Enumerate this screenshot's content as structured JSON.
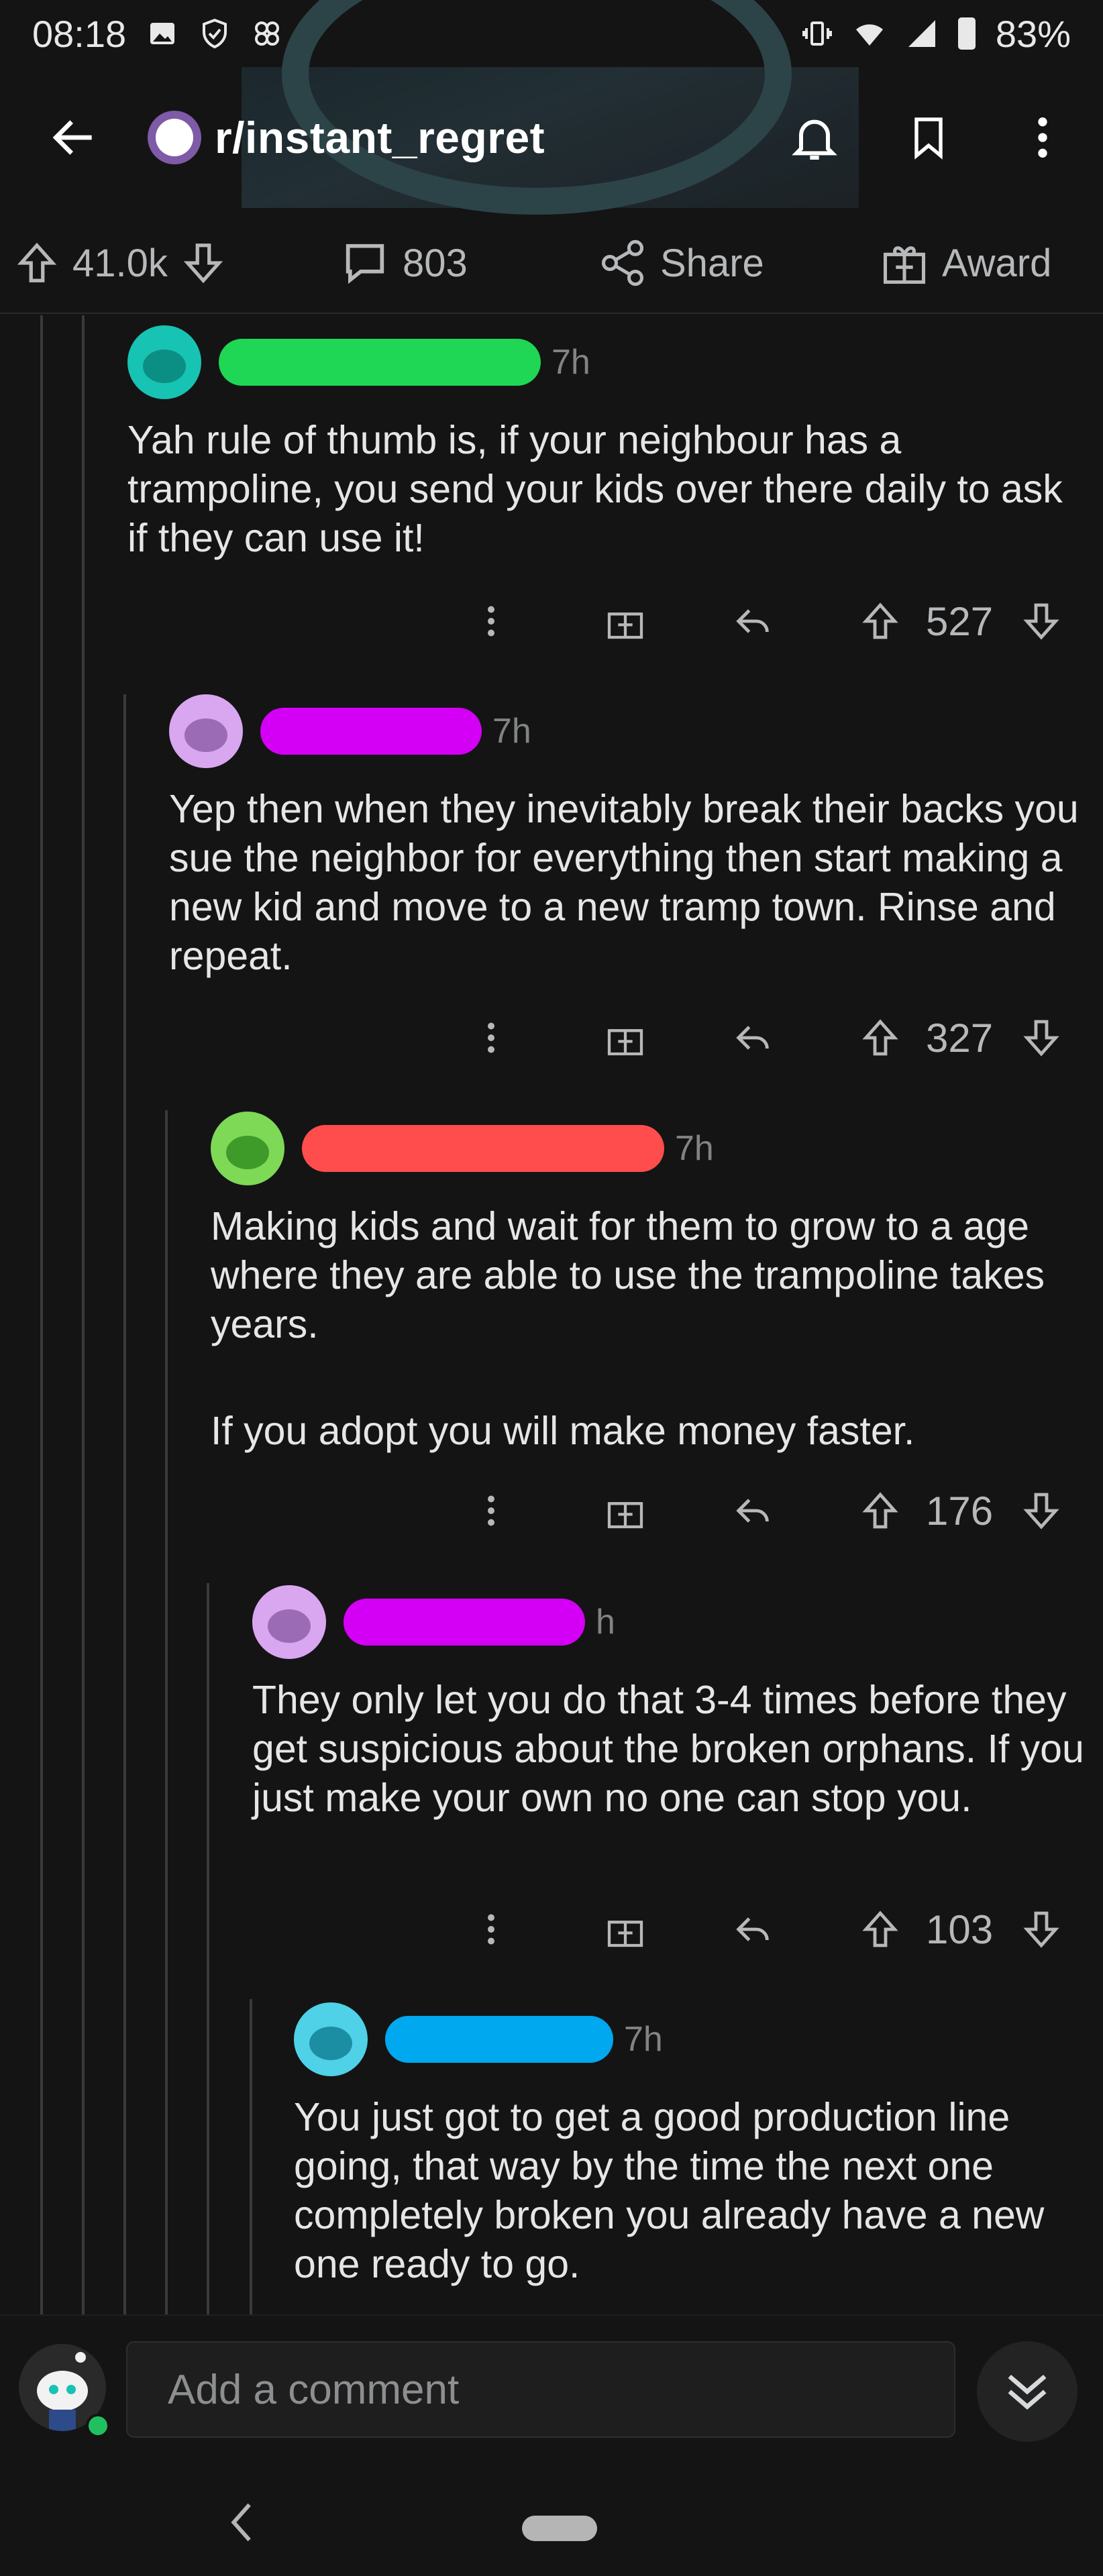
{
  "status_bar": {
    "time": "08:18",
    "battery": "83%"
  },
  "header": {
    "subreddit": "r/instant_regret",
    "icons": [
      "back-arrow-icon",
      "bell-icon",
      "bookmark-icon",
      "more-vertical-icon"
    ]
  },
  "post_actions": {
    "votes": "41.0k",
    "comments": "803",
    "share_label": "Share",
    "award_label": "Award"
  },
  "comments": [
    {
      "time": "7h",
      "avatar_color": "#17c3b2",
      "redact_color": "#1fd655",
      "body": [
        "Yah rule of thumb is, if your neighbour has a trampoline, you send your kids over there daily to ask if they can use it!"
      ],
      "score": "527"
    },
    {
      "time": "7h",
      "avatar_color": "#d9a6f0",
      "redact_color": "#d400f5",
      "body": [
        "Yep then when they inevitably break their backs you sue the neighbor for everything then start making a new kid and move to a new tramp town. Rinse and repeat."
      ],
      "score": "327"
    },
    {
      "time": "7h",
      "avatar_color": "#7ed957",
      "redact_color": "#ff4d4d",
      "body": [
        "Making kids and wait for them to grow to a age where they are able to use the trampoline takes years.",
        "If you adopt you will make money faster."
      ],
      "score": "176"
    },
    {
      "time": "h",
      "avatar_color": "#d9a6f0",
      "redact_color": "#d400f5",
      "body": [
        "They only let you do that 3-4 times before they get suspicious about the broken orphans. If you just make your own no one can stop you."
      ],
      "score": "103"
    },
    {
      "time": "7h",
      "avatar_color": "#4fd1e8",
      "redact_color": "#00a8f0",
      "body": [
        "You just got to get a good production line going, that way by the time the next one completely broken you already have a new one ready to go."
      ],
      "score": ""
    }
  ],
  "composer": {
    "placeholder": "Add a comment"
  },
  "colors": {
    "background": "#141414",
    "text": "#e6e6e6",
    "muted": "#818384",
    "thread_line": "#3a3a3c"
  }
}
